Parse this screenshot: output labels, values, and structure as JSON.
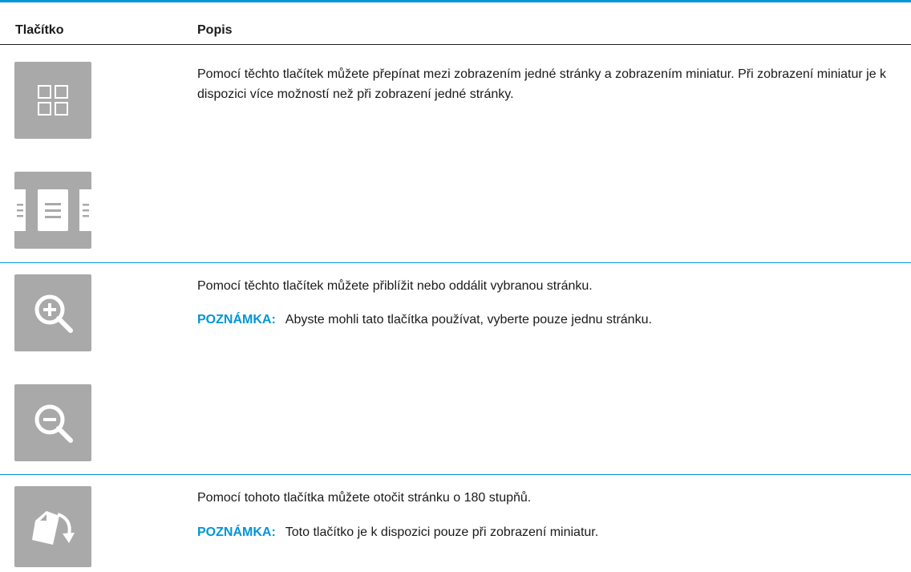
{
  "table": {
    "headers": {
      "button": "Tlačítko",
      "description": "Popis"
    },
    "rows": [
      {
        "icons": [
          "thumbnail-grid-icon",
          "single-page-view-icon"
        ],
        "description": "Pomocí těchto tlačítek můžete přepínat mezi zobrazením jedné stránky a zobrazením miniatur. Při zobrazení miniatur je k dispozici více možností než při zobrazení jedné stránky."
      },
      {
        "icons": [
          "zoom-in-icon",
          "zoom-out-icon"
        ],
        "description": "Pomocí těchto tlačítek můžete přiblížit nebo oddálit vybranou stránku.",
        "note_label": "POZNÁMKA:",
        "note_text": "Abyste mohli tato tlačítka používat, vyberte pouze jednu stránku."
      },
      {
        "icons": [
          "rotate-page-icon"
        ],
        "description": "Pomocí tohoto tlačítka můžete otočit stránku o 180 stupňů.",
        "note_label": "POZNÁMKA:",
        "note_text": "Toto tlačítko je k dispozici pouze při zobrazení miniatur."
      }
    ]
  },
  "colors": {
    "accent": "#0096d6",
    "icon_bg": "#a9a9a9",
    "icon_fg": "#ffffff"
  }
}
